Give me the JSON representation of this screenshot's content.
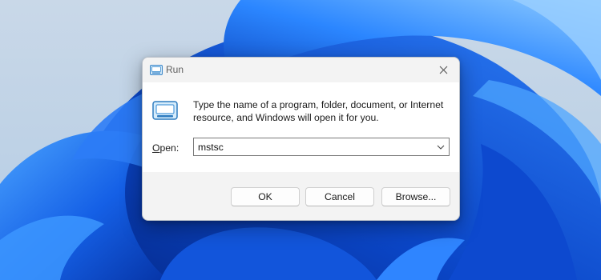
{
  "desktop": {
    "wallpaper": "windows-11-bloom",
    "colors": {
      "sky": "#cfdcea",
      "deep_blue": "#0a3fb8",
      "mid_blue": "#1e6ff0",
      "light_blue": "#63b3ff"
    }
  },
  "dialog": {
    "title": "Run",
    "title_icon": "run-icon",
    "close_icon": "close-icon",
    "description": "Type the name of a program, folder, document, or Internet resource, and Windows will open it for you.",
    "big_icon": "run-icon",
    "open_label_accel": "O",
    "open_label_rest": "pen:",
    "open_value": "mstsc",
    "open_dropdown_icon": "chevron-down-icon",
    "buttons": {
      "ok": "OK",
      "cancel": "Cancel",
      "browse": "Browse..."
    }
  }
}
